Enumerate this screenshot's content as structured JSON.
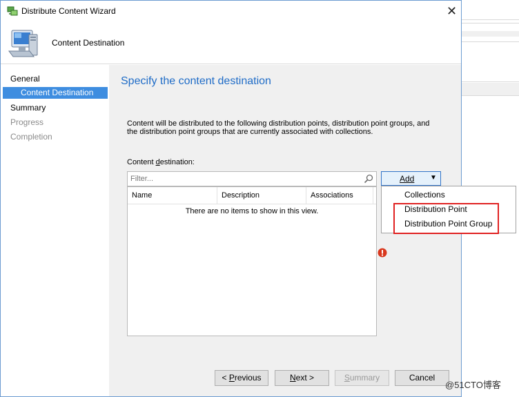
{
  "window": {
    "title": "Distribute Content Wizard",
    "close_glyph": "✕"
  },
  "header": {
    "title": "Content Destination",
    "icon": "computer-icon"
  },
  "nav": {
    "items": [
      {
        "label": "General",
        "state": "normal"
      },
      {
        "label": "Content Destination",
        "state": "selected"
      },
      {
        "label": "Summary",
        "state": "normal"
      },
      {
        "label": "Progress",
        "state": "disabled"
      },
      {
        "label": "Completion",
        "state": "disabled"
      }
    ]
  },
  "content": {
    "heading": "Specify the content destination",
    "description": "Content will be distributed to the following distribution points, distribution point groups, and the distribution point groups that are currently associated with collections.",
    "destination_label_prefix": "Content ",
    "destination_label_accel": "d",
    "destination_label_suffix": "estination:",
    "filter_placeholder": "Filter...",
    "filter_value": "",
    "columns": [
      "Name",
      "Description",
      "Associations"
    ],
    "empty_message": "There are no items to show in this view."
  },
  "add_menu": {
    "button_label": "Add",
    "arrow_glyph": "▼",
    "items": [
      "Collections",
      "Distribution Point",
      "Distribution Point Group"
    ],
    "highlighted_items": [
      "Distribution Point",
      "Distribution Point Group"
    ],
    "highlight_color": "#e02020"
  },
  "footer": {
    "previous_prefix": "< ",
    "previous_accel": "P",
    "previous_suffix": "revious",
    "next_accel": "N",
    "next_suffix": "ext >",
    "summary_accel": "S",
    "summary_suffix": "ummary",
    "cancel_label": "Cancel"
  },
  "watermark": "@51CTO博客",
  "colors": {
    "accent": "#1f6cc7",
    "selection": "#3e8de0",
    "error": "#d9381e"
  }
}
